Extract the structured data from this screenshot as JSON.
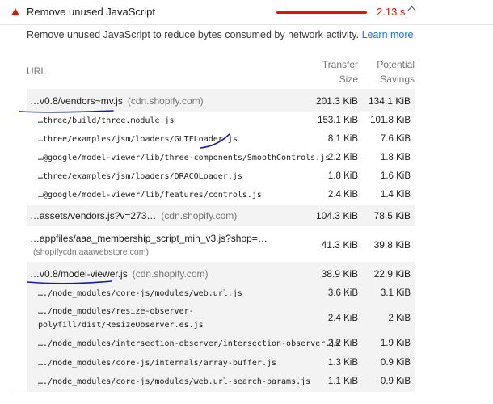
{
  "header": {
    "title": "Remove unused JavaScript",
    "savings": "2.13 s",
    "warn_color": "#eb0f00",
    "expand_icon": "chevron-up-icon"
  },
  "description": {
    "text": "Remove unused JavaScript to reduce bytes consumed by network activity. ",
    "link": "Learn more"
  },
  "table": {
    "col_url": "URL",
    "col_transfer_1": "Transfer",
    "col_transfer_2": "Size",
    "col_savings_1": "Potential",
    "col_savings_2": "Savings",
    "rows": [
      {
        "url": "…v0.8/vendors~mv.js",
        "host": "(cdn.shopify.com)",
        "transfer": "201.3 KiB",
        "savings": "134.1 KiB"
      },
      {
        "url": "…three/build/three.module.js",
        "transfer": "153.1 KiB",
        "savings": "101.8 KiB"
      },
      {
        "url": "…three/examples/jsm/loaders/GLTFLoader.js",
        "transfer": "8.1 KiB",
        "savings": "7.6 KiB"
      },
      {
        "url": "…@google/model-viewer/lib/three-components/SmoothControls.js",
        "transfer": "2.2 KiB",
        "savings": "1.8 KiB"
      },
      {
        "url": "…three/examples/jsm/loaders/DRACOLoader.js",
        "transfer": "1.8 KiB",
        "savings": "1.6 KiB"
      },
      {
        "url": "…@google/model-viewer/lib/features/controls.js",
        "transfer": "2.4 KiB",
        "savings": "1.4 KiB"
      },
      {
        "url": "…assets/vendors.js?v=273…",
        "host": "(cdn.shopify.com)",
        "transfer": "104.3 KiB",
        "savings": "78.5 KiB"
      },
      {
        "url": "…appfiles/aaa_membership_script_min_v3.js?shop=…",
        "host": "(shopifycdn.aaawebstore.com)",
        "transfer": "41.3 KiB",
        "savings": "39.8 KiB"
      },
      {
        "url": "…v0.8/model-viewer.js",
        "host": "(cdn.shopify.com)",
        "transfer": "38.9 KiB",
        "savings": "22.9 KiB"
      },
      {
        "url": "…./node_modules/core-js/modules/web.url.js",
        "transfer": "3.6 KiB",
        "savings": "3.1 KiB"
      },
      {
        "url": "…./node_modules/resize-observer-",
        "url2": "polyfill/dist/ResizeObserver.es.js",
        "transfer": "2.4 KiB",
        "savings": "2 KiB"
      },
      {
        "url": "…./node_modules/intersection-observer/intersection-observer.js",
        "transfer": "2.2 KiB",
        "savings": "1.9 KiB"
      },
      {
        "url": "…./node_modules/core-js/internals/array-buffer.js",
        "transfer": "1.3 KiB",
        "savings": "0.9 KiB"
      },
      {
        "url": "…./node_modules/core-js/modules/web.url-search-params.js",
        "transfer": "1.1 KiB",
        "savings": "0.9 KiB"
      }
    ]
  }
}
